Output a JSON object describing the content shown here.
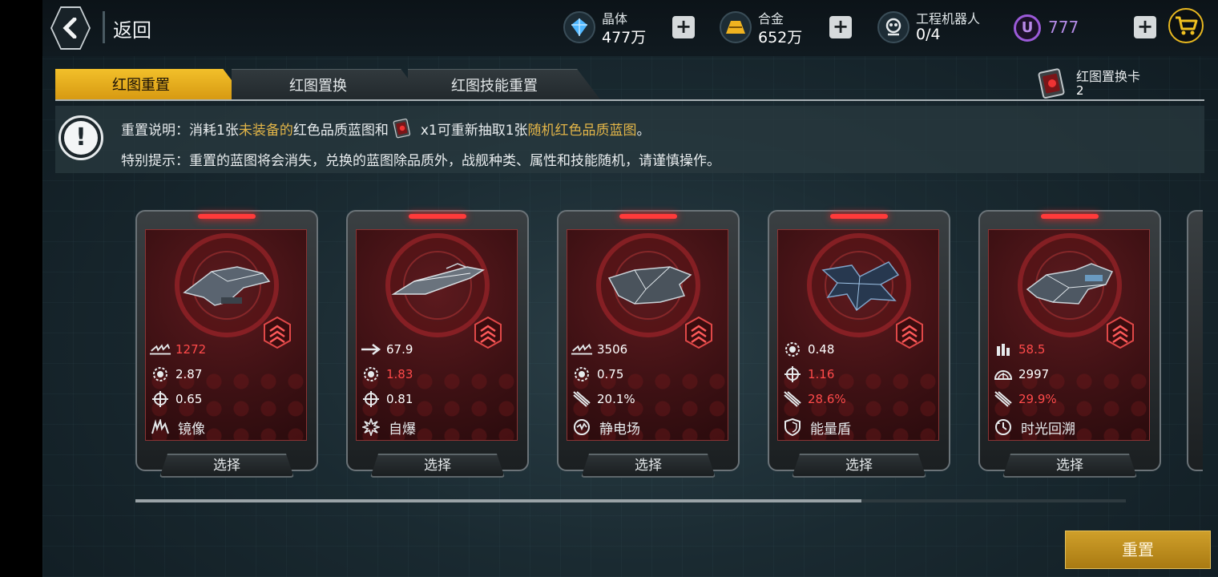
{
  "header": {
    "back_label": "返回",
    "resources": [
      {
        "name": "crystal",
        "label": "晶体",
        "value": "477万",
        "icon": "crystal-icon",
        "color": "#4fb7ff"
      },
      {
        "name": "alloy",
        "label": "合金",
        "value": "652万",
        "icon": "alloy-icon",
        "color": "#f0b320"
      },
      {
        "name": "robot",
        "label": "工程机器人",
        "value": "0/4",
        "icon": "robot-icon",
        "color": "#e6eaec"
      }
    ],
    "premium": {
      "badge": "U",
      "value": "777",
      "color": "#9b5ad8"
    }
  },
  "tabs": [
    {
      "label": "红图重置",
      "active": true
    },
    {
      "label": "红图置换",
      "active": false
    },
    {
      "label": "红图技能重置",
      "active": false
    }
  ],
  "swap_card": {
    "label": "红图置换卡",
    "count": "2"
  },
  "info": {
    "line1": {
      "prefix": "重置说明：消耗1张",
      "hl1": "未装备的",
      "mid": "红色品质蓝图和",
      "qty": "x1",
      "mid2": "可重新抽取1张",
      "hl2": "随机红色品质蓝图",
      "suffix": "。"
    },
    "line2": "特别提示：重置的蓝图将会消失，兑换的蓝图除品质外，战舰种类、属性和技能随机，请谨慎操作。"
  },
  "cards": [
    {
      "stats": [
        {
          "icon": "firepower-icon",
          "value": "1272",
          "color": "red"
        },
        {
          "icon": "gear-icon",
          "value": "2.87",
          "color": "white"
        },
        {
          "icon": "crosshair-icon",
          "value": "0.65",
          "color": "white"
        }
      ],
      "skill": {
        "icon": "mirror-icon",
        "label": "镜像"
      },
      "select_label": "选择"
    },
    {
      "stats": [
        {
          "icon": "speed-arrow-icon",
          "value": "67.9",
          "color": "white"
        },
        {
          "icon": "gear-icon",
          "value": "1.83",
          "color": "red"
        },
        {
          "icon": "crosshair-icon",
          "value": "0.81",
          "color": "white"
        }
      ],
      "skill": {
        "icon": "explosion-icon",
        "label": "自爆"
      },
      "select_label": "选择"
    },
    {
      "stats": [
        {
          "icon": "firepower-icon",
          "value": "3506",
          "color": "white"
        },
        {
          "icon": "gear-icon",
          "value": "0.75",
          "color": "white"
        },
        {
          "icon": "missile-icon",
          "value": "20.1%",
          "color": "white"
        }
      ],
      "skill": {
        "icon": "static-field-icon",
        "label": "静电场"
      },
      "select_label": "选择"
    },
    {
      "stats": [
        {
          "icon": "gear-icon",
          "value": "0.48",
          "color": "white"
        },
        {
          "icon": "crosshair-icon",
          "value": "1.16",
          "color": "red"
        },
        {
          "icon": "missile-icon",
          "value": "28.6%",
          "color": "red"
        }
      ],
      "skill": {
        "icon": "shield-icon",
        "label": "能量盾"
      },
      "select_label": "选择"
    },
    {
      "stats": [
        {
          "icon": "ammo-icon",
          "value": "58.5",
          "color": "red"
        },
        {
          "icon": "radar-icon",
          "value": "2997",
          "color": "white"
        },
        {
          "icon": "missile-icon",
          "value": "29.9%",
          "color": "red"
        }
      ],
      "skill": {
        "icon": "time-rewind-icon",
        "label": "时光回溯"
      },
      "select_label": "选择"
    }
  ],
  "scroll_progress": 0.733,
  "reset_button": "重置"
}
